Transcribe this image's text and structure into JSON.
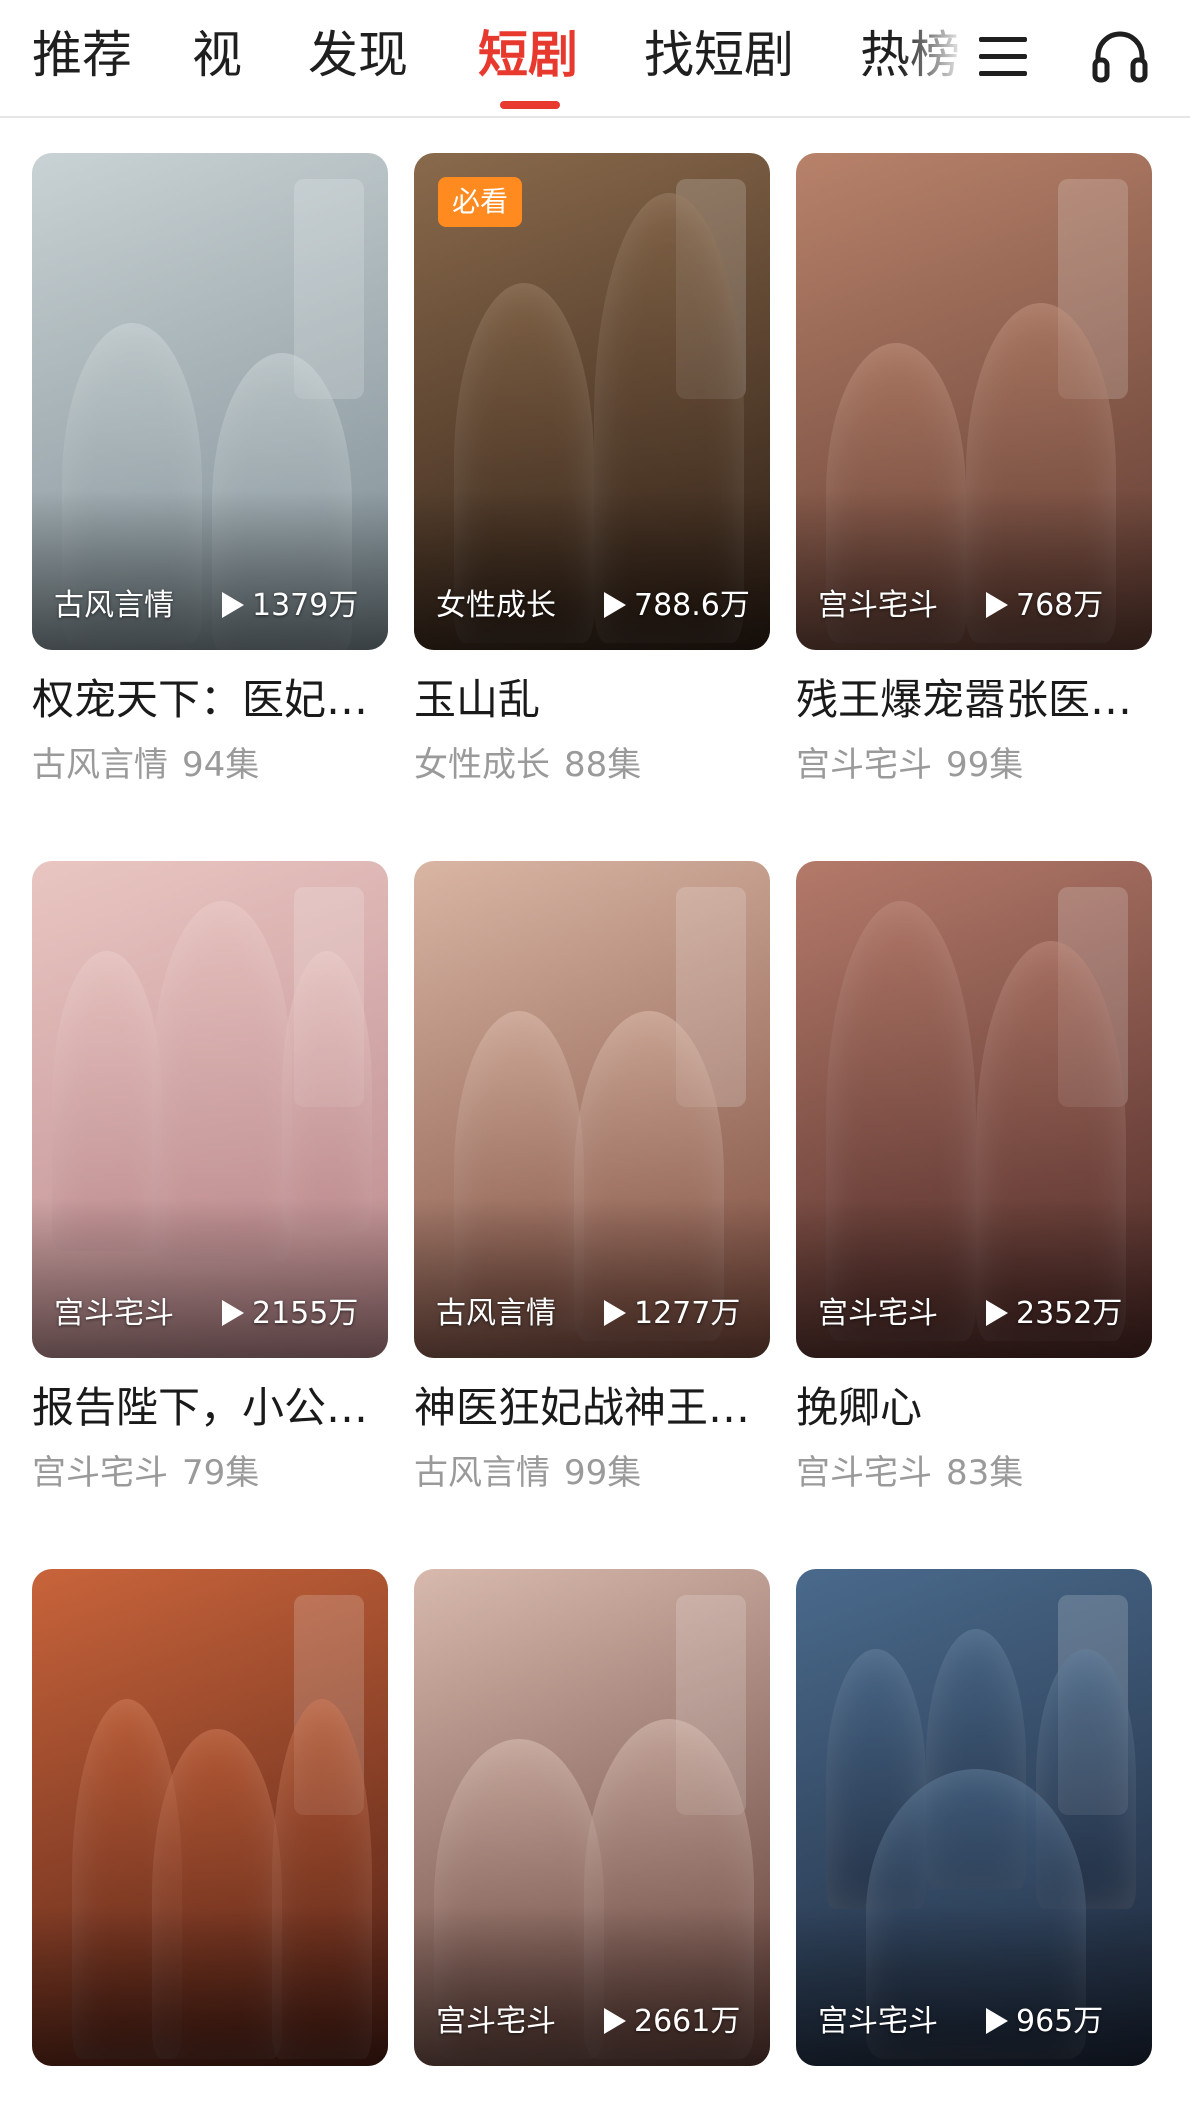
{
  "tabs": [
    {
      "label": "推荐"
    },
    {
      "label": "视"
    },
    {
      "label": "发现"
    },
    {
      "label": "短剧",
      "active": true
    },
    {
      "label": "找短剧"
    },
    {
      "label": "热榜"
    }
  ],
  "header_icons": {
    "menu": "menu-icon",
    "audio": "headphone-icon"
  },
  "accent_color": "#e8392f",
  "cards": [
    {
      "title": "权宠天下：医妃…",
      "genre": "古风言情",
      "plays": "1379万",
      "episodes": "94集",
      "badge": "",
      "palette": [
        "#c9d2d4",
        "#7d8c93"
      ]
    },
    {
      "title": "玉山乱",
      "genre": "女性成长",
      "plays": "788.6万",
      "episodes": "88集",
      "badge": "必看",
      "palette": [
        "#8a6a4c",
        "#2c1d14"
      ]
    },
    {
      "title": "残王爆宠嚣张医…",
      "genre": "宫斗宅斗",
      "plays": "768万",
      "episodes": "99集",
      "badge": "",
      "palette": [
        "#b8826a",
        "#5e3a31"
      ]
    },
    {
      "title": "报告陛下，小公…",
      "genre": "宫斗宅斗",
      "plays": "2155万",
      "episodes": "79集",
      "badge": "",
      "palette": [
        "#e9c6c2",
        "#b9868a"
      ]
    },
    {
      "title": "神医狂妃战神王…",
      "genre": "古风言情",
      "plays": "1277万",
      "episodes": "99集",
      "badge": "",
      "palette": [
        "#d9b5a4",
        "#7a4a3c"
      ]
    },
    {
      "title": "挽卿心",
      "genre": "宫斗宅斗",
      "plays": "2352万",
      "episodes": "83集",
      "badge": "",
      "palette": [
        "#b47a6a",
        "#4a2724"
      ]
    },
    {
      "title": "",
      "genre": "",
      "plays": "",
      "episodes": "",
      "badge": "",
      "palette": [
        "#c8643b",
        "#4d1e14"
      ]
    },
    {
      "title": "",
      "genre": "宫斗宅斗",
      "plays": "2661万",
      "episodes": "",
      "badge": "",
      "palette": [
        "#d8b9ad",
        "#5c3a33"
      ]
    },
    {
      "title": "",
      "genre": "宫斗宅斗",
      "plays": "965万",
      "episodes": "",
      "badge": "",
      "palette": [
        "#4a6a8c",
        "#1c2638"
      ]
    }
  ]
}
